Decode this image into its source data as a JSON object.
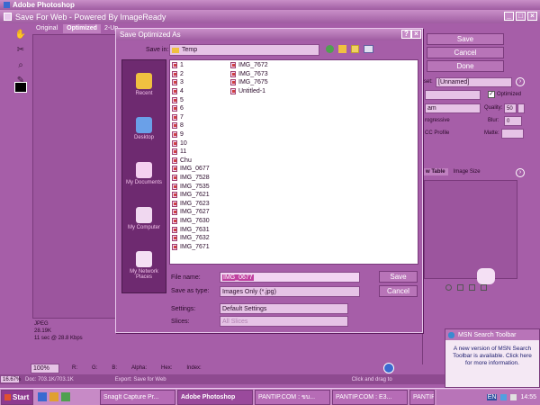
{
  "app": {
    "title": "Adobe Photoshop"
  },
  "sfw": {
    "title": "Save For Web - Powered By ImageReady",
    "tabs": [
      "Original",
      "Optimized",
      "2-Up"
    ],
    "save": "Save",
    "cancel": "Cancel",
    "done": "Done",
    "preset_value": "[Unnamed]",
    "optimized_label": "Optimized",
    "quality_label": "Quality:",
    "quality_value": "50",
    "blur_label": "Blur:",
    "blur_value": "0",
    "matte_label": "Matte:",
    "progressive": "rogressive",
    "icc": "CC Profile",
    "format_frag": "am",
    "color_table_tab": "w Table",
    "image_size_tab": "Image Size",
    "preset_frag": "set:",
    "info": {
      "format": "JPEG",
      "size": "28.19K",
      "time": "11 sec @ 28.8 Kbps"
    },
    "zoom": "100%",
    "readouts": [
      "R:",
      "G:",
      "B:",
      "Alpha:",
      "Hex:",
      "Index:"
    ]
  },
  "dialog": {
    "title": "Save Optimized As",
    "save_in_label": "Save in:",
    "save_in_value": "Temp",
    "places": [
      "Recent",
      "Desktop",
      "My Documents",
      "My Computer",
      "My Network Places"
    ],
    "files_col1": [
      "1",
      "2",
      "3",
      "4",
      "5",
      "6",
      "7",
      "8",
      "9",
      "10",
      "11",
      "Chu",
      "IMG_0677",
      "IMG_7528",
      "IMG_7535",
      "IMG_7621",
      "IMG_7623",
      "IMG_7627",
      "IMG_7630",
      "IMG_7631",
      "IMG_7632",
      "IMG_7671"
    ],
    "files_col2": [
      "IMG_7672",
      "IMG_7673",
      "IMG_7675",
      "Untitled-1"
    ],
    "file_name_label": "File name:",
    "file_name_value": "IMG_0677",
    "save_type_label": "Save as type:",
    "save_type_value": "Images Only (*.jpg)",
    "settings_label": "Settings:",
    "settings_value": "Default Settings",
    "slices_label": "Slices:",
    "slices_value": "All Slices",
    "save": "Save",
    "cancel": "Cancel"
  },
  "statusbar": {
    "zoom": "16.67%",
    "doc": "Doc: 703.1K/703.1K",
    "hint": "Export: Save for Web",
    "hint2": "Click and drag to"
  },
  "msn": {
    "title": "MSN Search Toolbar",
    "message": "A new version of MSN Search Toolbar is available. Click here for more information."
  },
  "taskbar": {
    "start": "Start",
    "items": [
      "SnagIt Capture Pr...",
      "Adobe Photoshop",
      "PANTIP.COM : ขบ...",
      "PANTIP.COM : E3...",
      "PANTIP.COM : ฉา..."
    ],
    "lang": "EN",
    "clock": "14:55"
  },
  "colors": {
    "bg": "#a65ea8",
    "dialog": "#a65ea8",
    "list": "#ffffff",
    "sidebar": "#6e2a70",
    "accent": "#f4c4e6"
  }
}
